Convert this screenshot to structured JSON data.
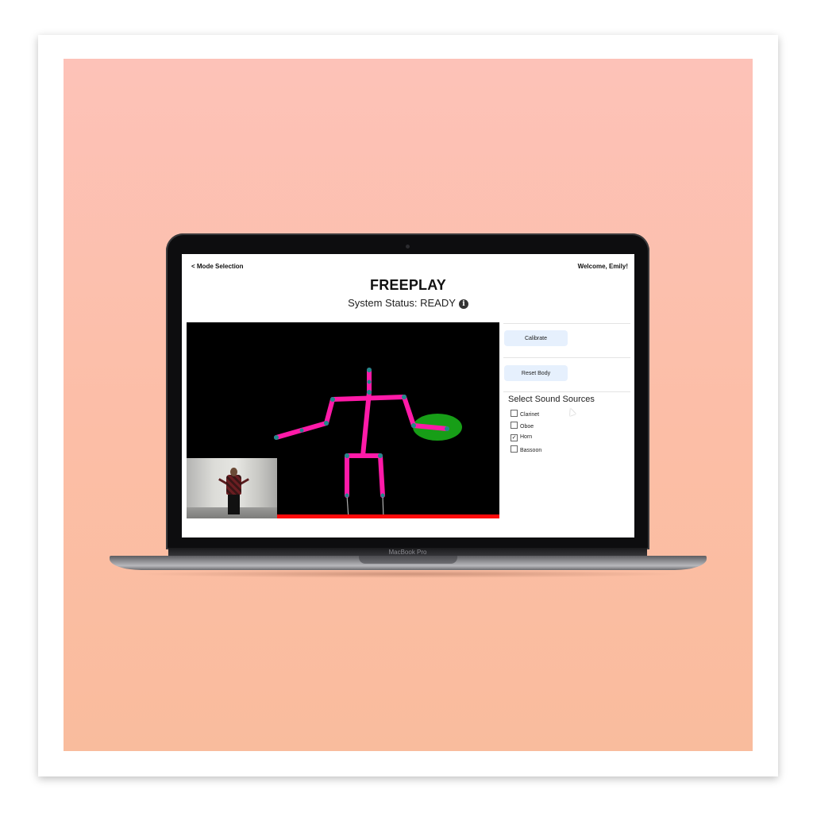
{
  "laptop": {
    "model_label": "MacBook Pro"
  },
  "app": {
    "nav": {
      "back_label": "< Mode Selection",
      "welcome": "Welcome, Emily!"
    },
    "title": "FREEPLAY",
    "status": "System Status: READY",
    "info_icon": "info-icon",
    "controls": {
      "calibrate_label": "Calibrate",
      "reset_label": "Reset Body",
      "sound_sources_heading": "Select Sound Sources",
      "sound_sources": [
        {
          "label": "Clarinet",
          "checked": false
        },
        {
          "label": "Oboe",
          "checked": false
        },
        {
          "label": "Horn",
          "checked": true
        },
        {
          "label": "Bassoon",
          "checked": false
        }
      ]
    },
    "colors": {
      "skeleton": "#ff1aa8",
      "joint": "#1f8a8a",
      "target_zone": "#179e17",
      "floor": "#ff0a0a",
      "button_bg": "#e6f0fd"
    }
  }
}
